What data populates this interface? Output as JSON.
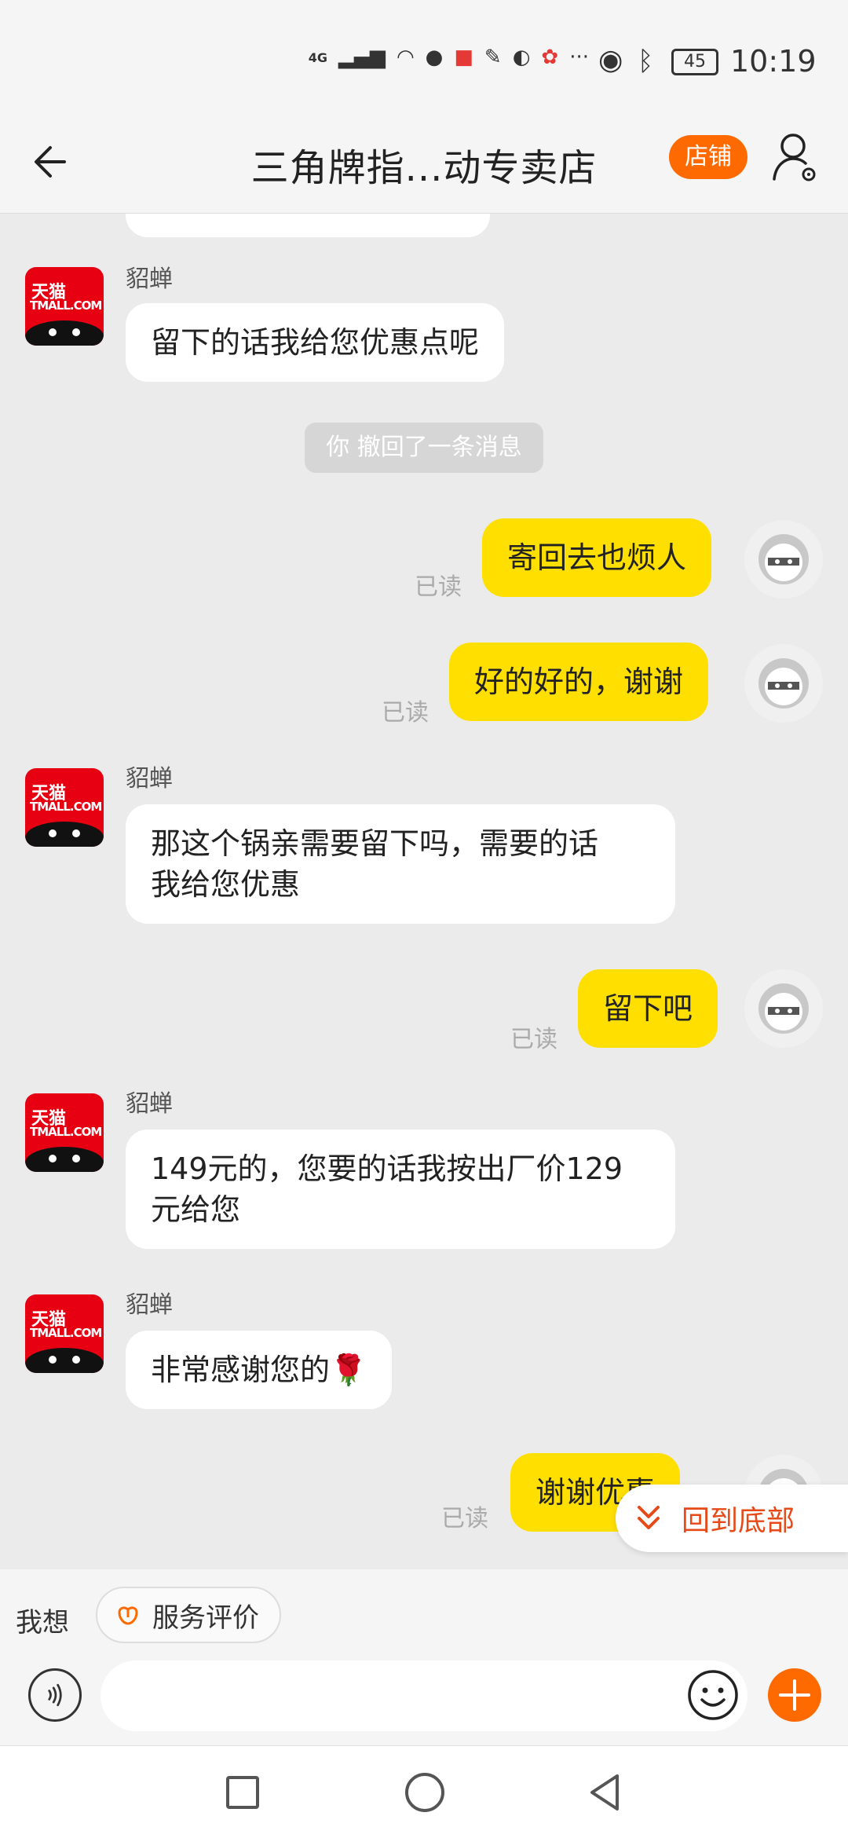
{
  "status_bar": {
    "signal": "4G",
    "battery": "45",
    "time": "10:19"
  },
  "header": {
    "title": "三角牌指...动专卖店",
    "shop_button": "店铺"
  },
  "messages": {
    "shop_name": "貂蝉",
    "read_label": "已读",
    "m1": "留下的话我给您优惠点呢",
    "system_recall": "你 撤回了一条消息",
    "m2": "寄回去也烦人",
    "m3": "好的好的，谢谢",
    "m4_line1": "那这个锅亲需要留下吗，需要的话",
    "m4_line2": "我给您优惠",
    "m5": "留下吧",
    "m6_line1": "149元的，您要的话我按出厂价129",
    "m6_line2": "元给您",
    "m7": "非常感谢您的🌹",
    "m8": "谢谢优惠"
  },
  "scroll_button": "回到底部",
  "bottom_bar": {
    "want_label": "我想",
    "service_eval": "服务评价"
  },
  "colors": {
    "accent": "#ff6a00",
    "my_bubble": "#ffdf00",
    "shop_red": "#e60012"
  }
}
